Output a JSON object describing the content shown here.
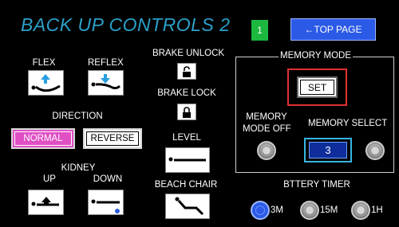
{
  "header": {
    "title": "BACK UP CONTROLS 2",
    "indicator": "1",
    "top_page_label": "←TOP PAGE"
  },
  "controls": {
    "flex": "FLEX",
    "reflex": "REFLEX",
    "brake_unlock": "BRAKE UNLOCK",
    "brake_lock": "BRAKE LOCK",
    "direction": "DIRECTION",
    "normal": "NORMAL",
    "reverse": "REVERSE",
    "level": "LEVEL",
    "kidney": "KIDNEY",
    "kidney_up": "UP",
    "kidney_down": "DOWN",
    "beach_chair": "BEACH CHAIR"
  },
  "memory": {
    "title": "MEMORY MODE",
    "set": "SET",
    "mode_off_line1": "MEMORY",
    "mode_off_line2": "MODE OFF",
    "select_label": "MEMORY SELECT",
    "select_value": "3"
  },
  "battery": {
    "title": "BTTERY TIMER",
    "options": [
      "3M",
      "15M",
      "1H"
    ],
    "selected": "3M"
  },
  "colors": {
    "title": "#2aa0c8",
    "accent_blue": "#2b5ae6",
    "indicator_green": "#1cb83f",
    "normal_pink": "#e04fc4",
    "set_border": "#e23131"
  }
}
